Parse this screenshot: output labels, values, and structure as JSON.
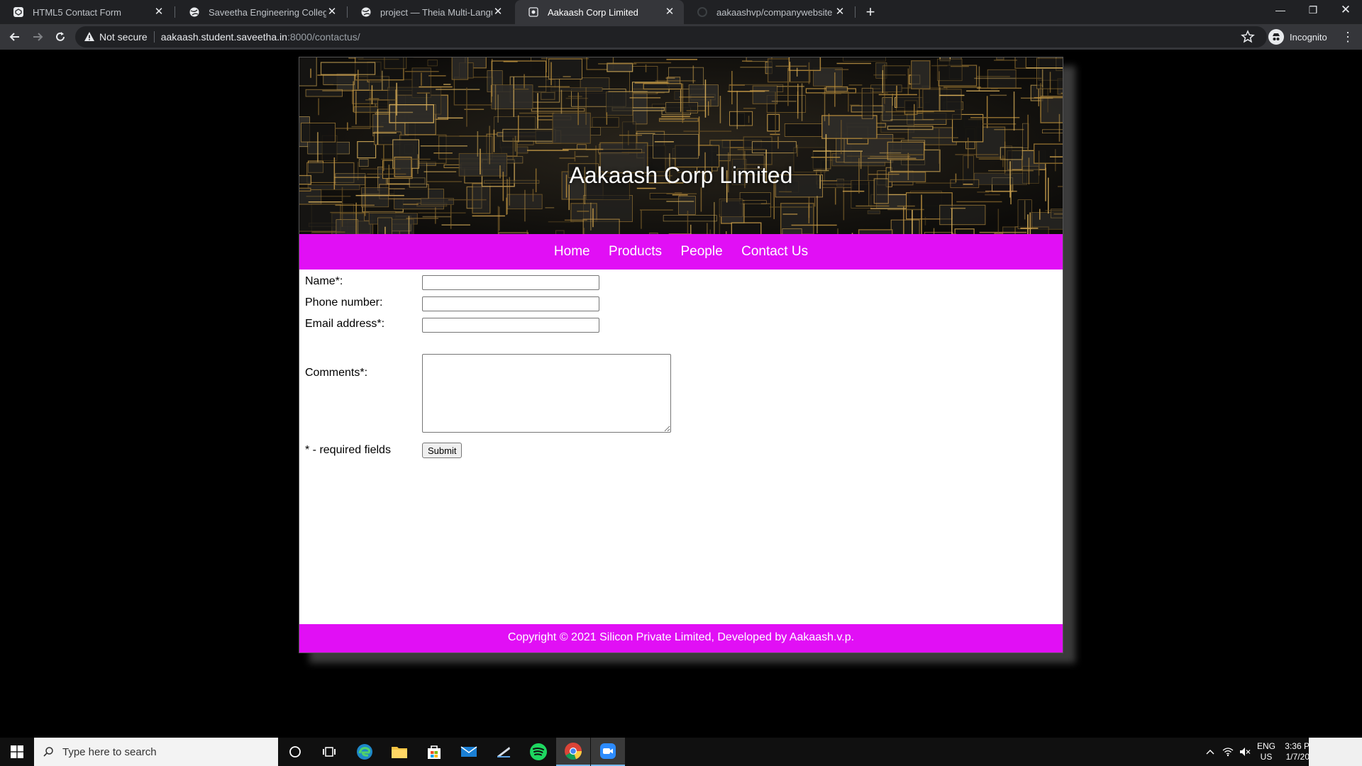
{
  "browser": {
    "tabs": [
      {
        "title": "HTML5 Contact Form",
        "active": false,
        "favicon": "codepen-icon"
      },
      {
        "title": "Saveetha Engineering College",
        "active": false,
        "favicon": "globe-icon"
      },
      {
        "title": "project — Theia Multi-Language",
        "active": false,
        "favicon": "globe-icon"
      },
      {
        "title": "Aakaash Corp Limited",
        "active": true,
        "favicon": "page-icon"
      },
      {
        "title": "aakaashvp/companywebsite",
        "active": false,
        "favicon": "loading-icon"
      }
    ],
    "security_label": "Not secure",
    "url_host": "aakaash.student.saveetha.in",
    "url_rest": ":8000/contactus/",
    "profile_label": "Incognito"
  },
  "page": {
    "banner_title": "Aakaash Corp Limited",
    "menu": [
      "Home",
      "Products",
      "People",
      "Contact Us"
    ],
    "form": {
      "name_label": "Name*:",
      "phone_label": "Phone number:",
      "email_label": "Email address*:",
      "comments_label": "Comments*:",
      "required_note": "* - required fields",
      "submit_label": "Submit",
      "name_value": "",
      "phone_value": "",
      "email_value": "",
      "comments_value": ""
    },
    "footer": "Copyright © 2021 Silicon Private Limited, Developed by Aakaash.v.p.",
    "accent_color": "#e10ff5"
  },
  "taskbar": {
    "search_placeholder": "Type here to search",
    "apps": [
      "cortana-icon",
      "task-view-icon",
      "edge-icon",
      "file-explorer-icon",
      "store-icon",
      "mail-icon",
      "app-icon",
      "spotify-icon",
      "chrome-icon",
      "zoom-icon"
    ],
    "lang_top": "ENG",
    "lang_bottom": "US",
    "time": "3:36 P",
    "date": "1/7/20"
  }
}
